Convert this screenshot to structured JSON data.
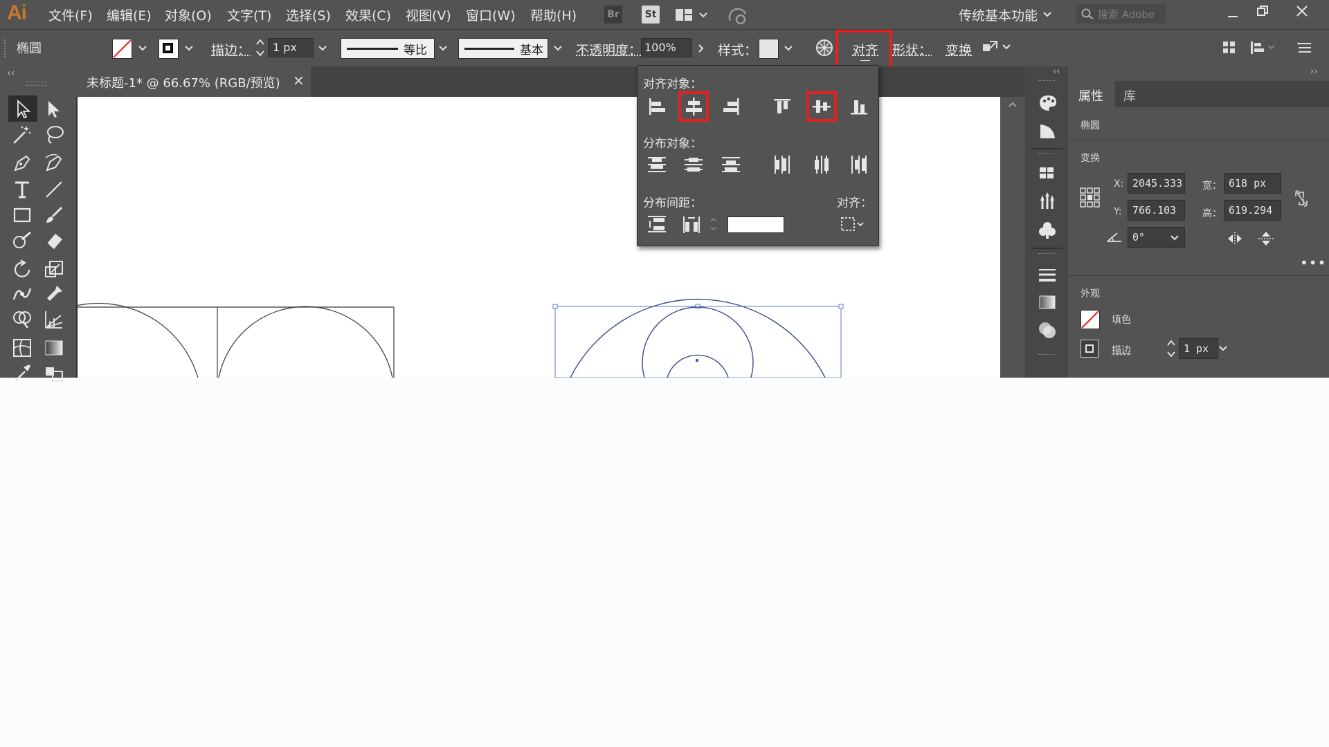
{
  "app": {
    "logo": "Ai",
    "menus": [
      "文件(F)",
      "编辑(E)",
      "对象(O)",
      "文字(T)",
      "选择(S)",
      "效果(C)",
      "视图(V)",
      "窗口(W)",
      "帮助(H)"
    ],
    "bridge_label": "Br",
    "stock_label": "St",
    "workspace": "传统基本功能",
    "search_placeholder": "搜索 Adobe"
  },
  "control_bar": {
    "object_type": "椭圆",
    "stroke_label": "描边：",
    "stroke_weight": "1 px",
    "profile_label": "等比",
    "brush_label": "基本",
    "opacity_label": "不透明度：",
    "opacity_value": "100%",
    "style_label": "样式：",
    "align_label": "对齐",
    "shape_label": "形状：",
    "transform_label": "变换"
  },
  "document": {
    "tab_title": "未标题-1* @ 66.67% (RGB/预览)",
    "close": "×"
  },
  "align_panel": {
    "align_objects_label": "对齐对象：",
    "distribute_objects_label": "分布对象：",
    "distribute_spacing_label": "分布间距：",
    "align_to_label": "对齐：",
    "spacing_value": ""
  },
  "properties": {
    "tabs": [
      "属性",
      "库"
    ],
    "object_type": "椭圆",
    "transform_label": "变换",
    "x_label": "X:",
    "x_value": "2045.333",
    "y_label": "Y:",
    "y_value": "766.103",
    "w_label": "宽：",
    "w_value": "618 px",
    "h_label": "高：",
    "h_value": "619.294",
    "angle_value": "0°",
    "appearance_label": "外观",
    "fill_label": "填色",
    "stroke_label": "描边",
    "stroke_value": "1 px"
  },
  "colors": {
    "ui_bg": "#535353",
    "highlight": "#e32121",
    "accent_orange": "#c8782a",
    "shape_stroke": "#3b4a8a"
  }
}
